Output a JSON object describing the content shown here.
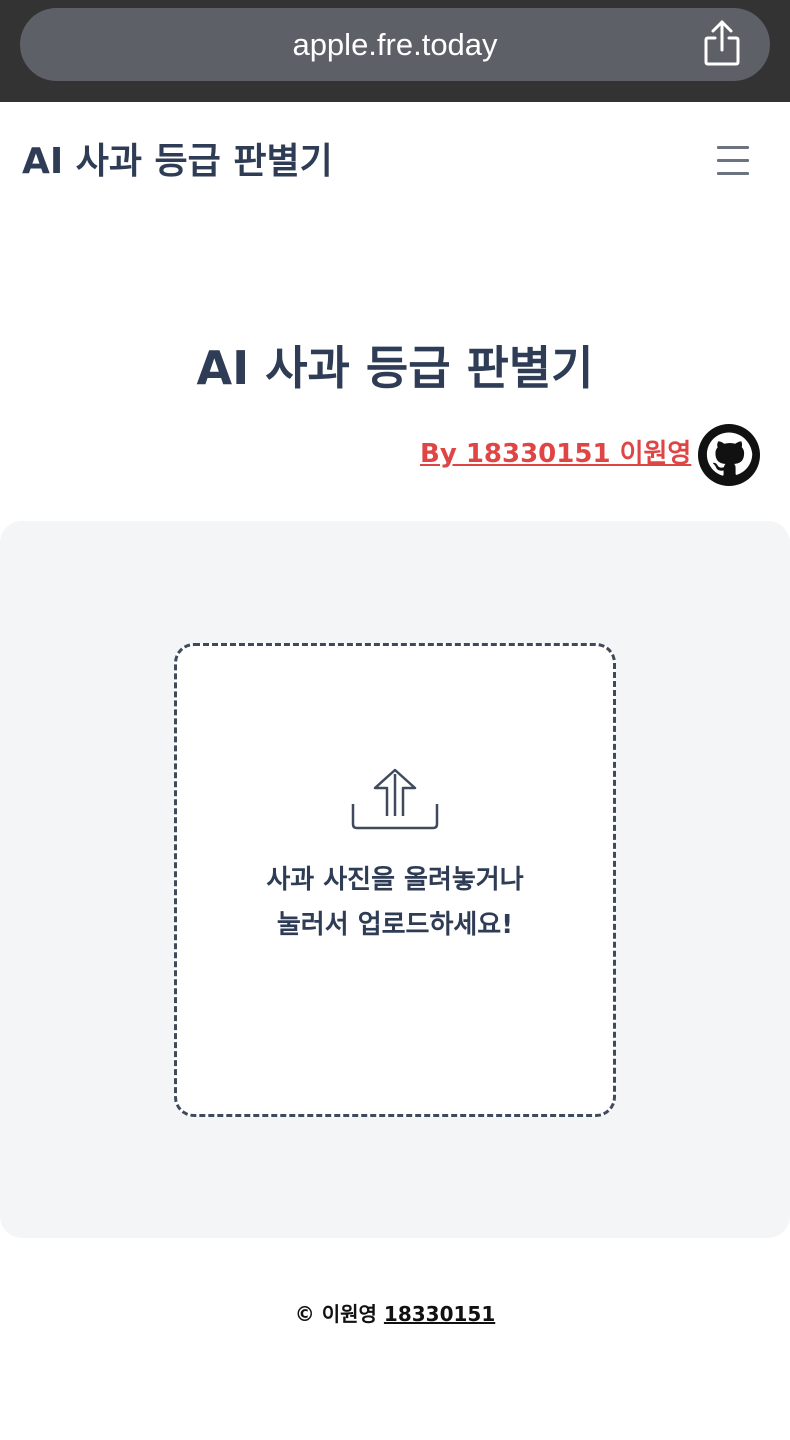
{
  "browser": {
    "url": "apple.fre.today",
    "share_icon": "share-icon"
  },
  "navbar": {
    "title": "AI 사과 등급 판별기",
    "menu_icon": "hamburger-icon"
  },
  "hero": {
    "title": "AI 사과 등급 판별기",
    "author_link": "By 18330151 이원영",
    "github_icon": "github-icon"
  },
  "upload": {
    "icon": "upload-icon",
    "instruction": "사과 사진을 올려놓거나 눌러서 업로드하세요!"
  },
  "footer": {
    "copyright_prefix": "© 이원영",
    "student_id": "18330151"
  },
  "colors": {
    "title": "#2f3c55",
    "author_link": "#e04545",
    "panel_bg": "#f4f5f7",
    "browser_bar": "#333334",
    "url_pill": "#5e6068"
  }
}
